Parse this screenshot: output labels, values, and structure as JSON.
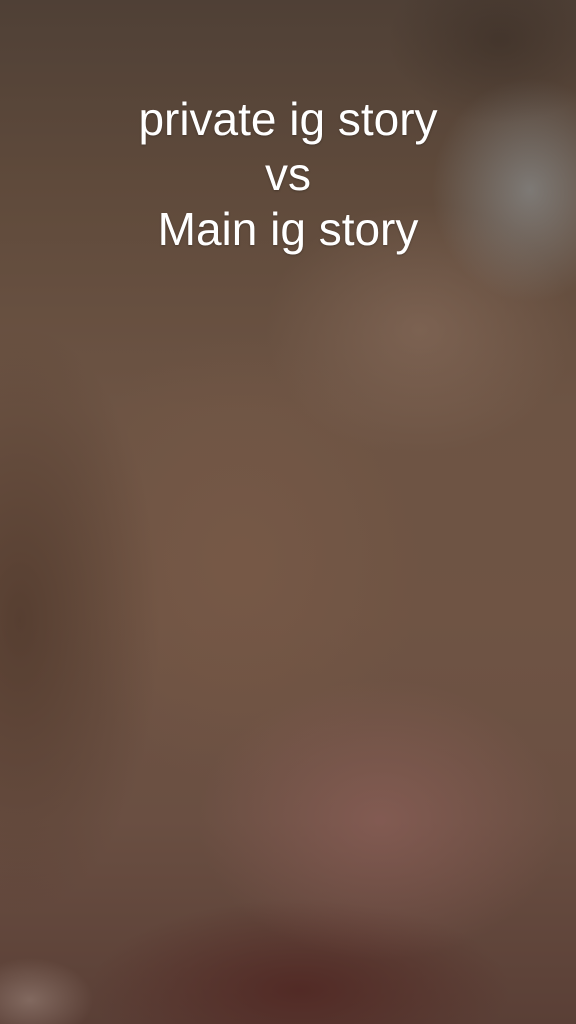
{
  "caption": {
    "line1": "private ig story",
    "line2": "vs",
    "line3": "Main ig story"
  }
}
